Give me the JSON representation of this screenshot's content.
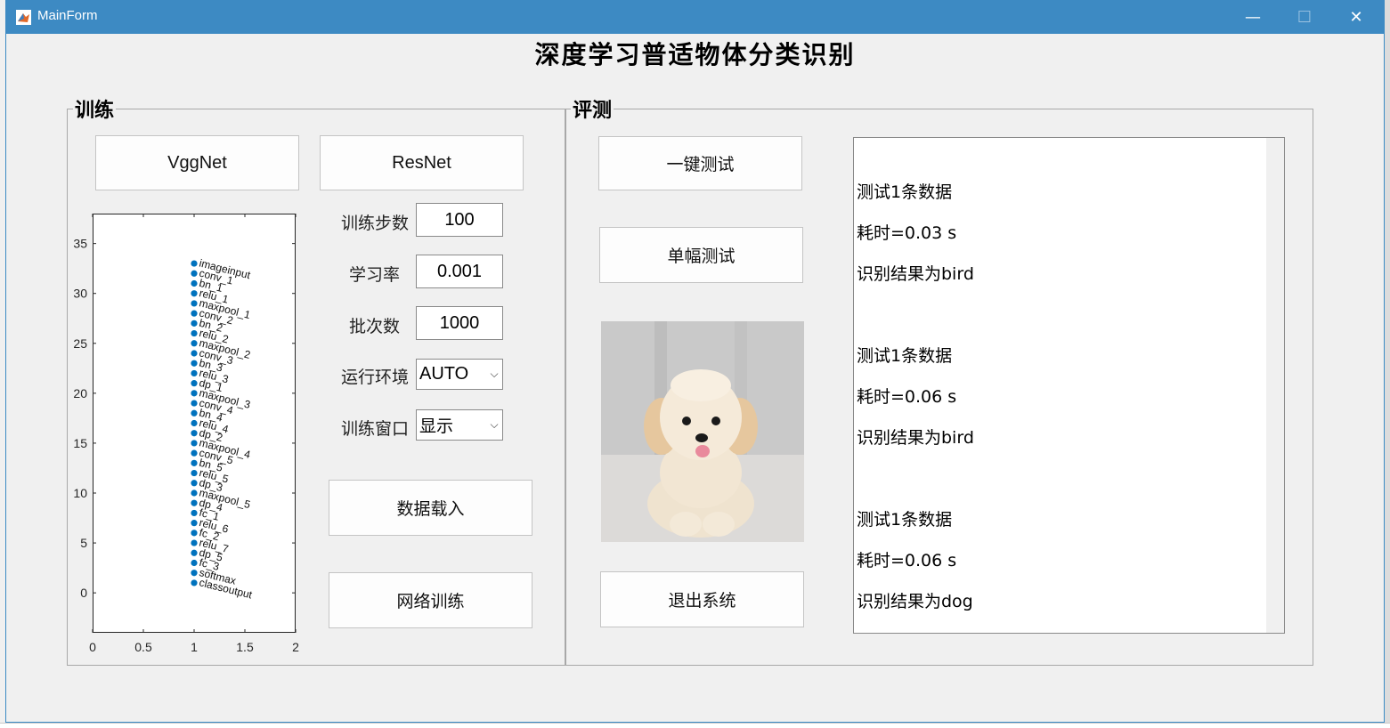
{
  "window": {
    "title": "MainForm",
    "minimize": "—",
    "maximize": "☐",
    "close": "✕"
  },
  "main_title": "深度学习普适物体分类识别",
  "train_panel": {
    "title": "训练",
    "vggnet_label": "VggNet",
    "resnet_label": "ResNet",
    "params": [
      {
        "label": "训练步数",
        "value": "100"
      },
      {
        "label": "学习率",
        "value": "0.001"
      },
      {
        "label": "批次数",
        "value": "1000"
      }
    ],
    "env_label": "运行环境",
    "env_value": "AUTO",
    "window_label": "训练窗口",
    "window_value": "显示",
    "load_data_label": "数据载入",
    "train_net_label": "网络训练"
  },
  "eval_panel": {
    "title": "评测",
    "one_click_test_label": "一键测试",
    "single_test_label": "单幅测试",
    "exit_label": "退出系统",
    "log_lines": [
      "",
      "测试1条数据",
      "耗时=0.03 s",
      "识别结果为bird",
      "",
      "测试1条数据",
      "耗时=0.06 s",
      "识别结果为bird",
      "",
      "测试1条数据",
      "耗时=0.06 s",
      "识别结果为dog"
    ]
  },
  "chart_data": {
    "type": "scatter",
    "xlim": [
      0,
      2
    ],
    "ylim": [
      -4,
      38
    ],
    "x_ticks": [
      "0",
      "0.5",
      "1",
      "1.5",
      "2"
    ],
    "y_ticks": [
      "0",
      "5",
      "10",
      "15",
      "20",
      "25",
      "30",
      "35"
    ],
    "marker_color": "#0072bd",
    "x": 1,
    "layers": [
      "imageinput",
      "conv_1",
      "bn_1",
      "relu_1",
      "maxpool_1",
      "conv_2",
      "bn_2",
      "relu_2",
      "maxpool_2",
      "conv_3",
      "bn_3",
      "relu_3",
      "dp_1",
      "maxpool_3",
      "conv_4",
      "bn_4",
      "relu_4",
      "dp_2",
      "maxpool_4",
      "conv_5",
      "bn_5",
      "relu_5",
      "dp_3",
      "maxpool_5",
      "dp_4",
      "fc_1",
      "relu_6",
      "fc_2",
      "relu_7",
      "dp_5",
      "fc_3",
      "softmax",
      "classoutput"
    ],
    "y_values": [
      33,
      32,
      31,
      30,
      29,
      28,
      27,
      26,
      25,
      24,
      23,
      22,
      21,
      20,
      19,
      18,
      17,
      16,
      15,
      14,
      13,
      12,
      11,
      10,
      9,
      8,
      7,
      6,
      5,
      4,
      3,
      2,
      1
    ]
  }
}
